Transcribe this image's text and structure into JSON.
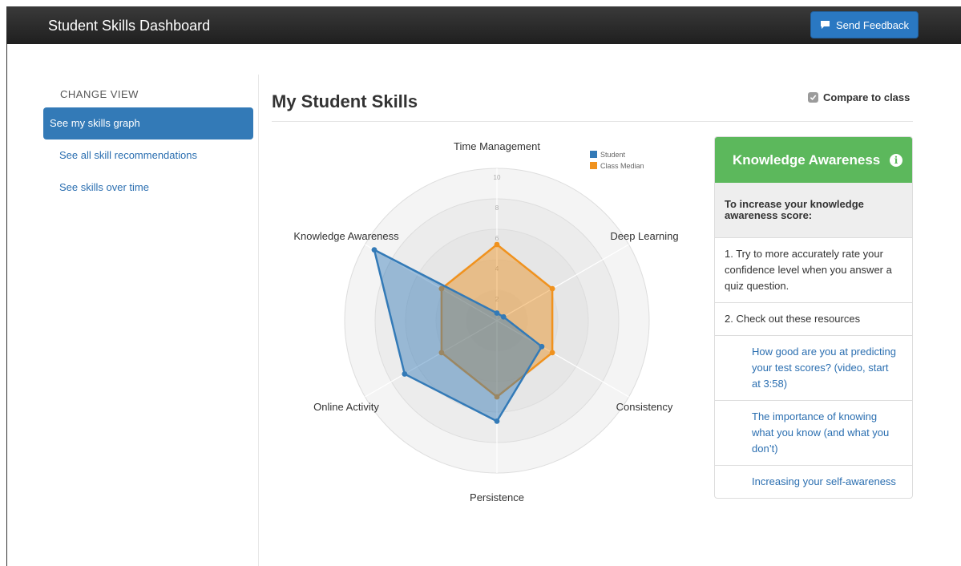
{
  "navbar": {
    "title": "Student Skills Dashboard",
    "feedback_label": "Send Feedback"
  },
  "sidebar": {
    "title": "CHANGE VIEW",
    "items": [
      {
        "label": "See my skills graph",
        "active": true
      },
      {
        "label": "See all skill recommendations",
        "active": false
      },
      {
        "label": "See skills over time",
        "active": false
      }
    ]
  },
  "main": {
    "title": "My Student Skills",
    "compare_label": "Compare to class",
    "compare_checked": true
  },
  "chart_data": {
    "type": "radar",
    "axes": [
      "Time Management",
      "Deep Learning",
      "Consistency",
      "Persistence",
      "Online Activity",
      "Knowledge Awareness"
    ],
    "ticks": [
      "2",
      "4",
      "6",
      "8",
      "10"
    ],
    "range": [
      0,
      10
    ],
    "series": [
      {
        "name": "Student",
        "color": "#337ab7",
        "values": [
          0.5,
          0.5,
          3.4,
          6.6,
          7.0,
          9.3
        ]
      },
      {
        "name": "Class Median",
        "color": "#f0921e",
        "values": [
          5.0,
          4.2,
          4.2,
          5.0,
          4.2,
          4.2
        ]
      }
    ]
  },
  "panel": {
    "title": "Knowledge Awareness",
    "subtitle": "To increase your knowledge awareness score:",
    "step1": "1. Try to more accurately rate your confidence level when you answer a quiz question.",
    "step2": "2. Check out these resources",
    "links": [
      "How good are you at predicting your test scores? (video, start at 3:58)",
      "The importance of knowing what you know (and what you don’t)",
      "Increasing your self-awareness"
    ]
  }
}
